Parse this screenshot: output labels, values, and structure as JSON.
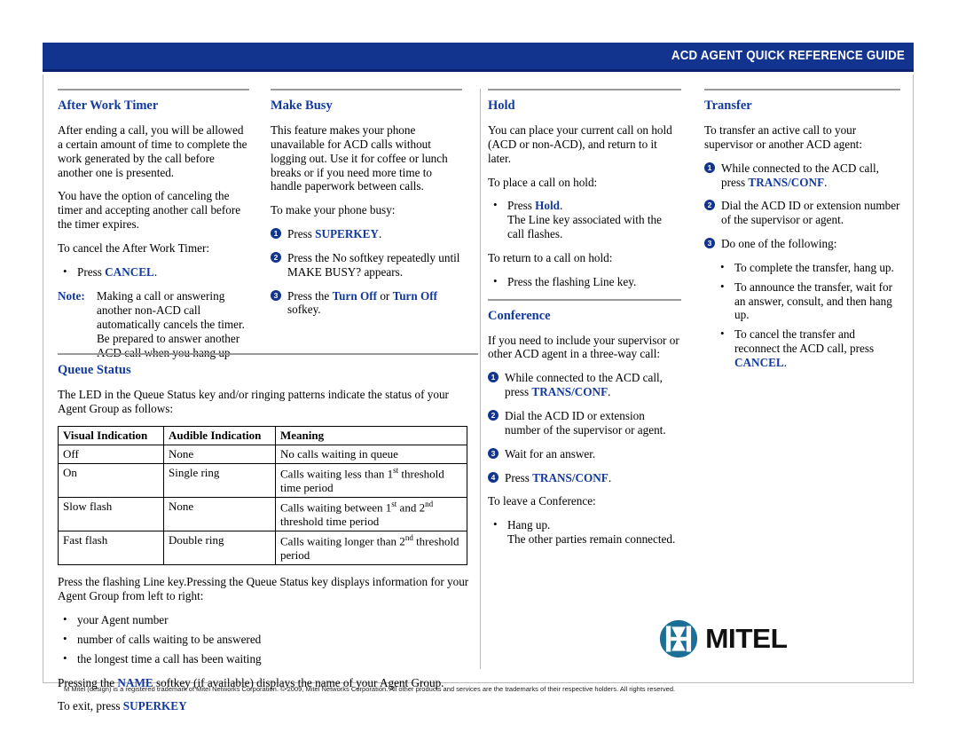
{
  "header": {
    "title": "ACD AGENT QUICK REFERENCE GUIDE"
  },
  "colors": {
    "brand_blue": "#12338e",
    "heading_blue": "#123a9e",
    "logo_teal": "#1b6f96"
  },
  "col1": {
    "heading": "After Work Timer",
    "p1": "After ending a call, you will be allowed a certain amount of time to complete the work generated by the call before another one is presented.",
    "p2": "You have the option of canceling the timer and accepting another call before the timer expires.",
    "p3": "To cancel the After Work Timer:",
    "bullet1_pre": "Press ",
    "bullet1_kw": "CANCEL",
    "bullet1_post": ".",
    "note_label": "Note:",
    "note_text": "Making a call or answering another non-ACD call automatically cancels the timer. Be prepared to answer another ACD call when you hang up"
  },
  "col2": {
    "heading": "Make Busy",
    "p1": "This feature makes your phone unavailable for ACD calls without logging out. Use it for coffee or lunch breaks or if you need more time to handle paperwork between calls.",
    "p2": "To make your phone busy:",
    "step1_num": "1",
    "step1_pre": "Press ",
    "step1_kw": "SUPERKEY",
    "step1_post": ".",
    "step2_num": "2",
    "step2_text": "Press the No softkey repeatedly until MAKE BUSY? appears.",
    "step3_num": "3",
    "step3_pre": "Press the ",
    "step3_kw1": "Turn Off",
    "step3_mid": " or ",
    "step3_kw2": "Turn Off",
    "step3_post": " sofkey."
  },
  "col3": {
    "hold_heading": "Hold",
    "hold_p1": "You can place your current call on hold (ACD or non-ACD), and return to it later.",
    "hold_p2": "To place a call on hold:",
    "hold_b1_pre": "Press ",
    "hold_b1_kw": "Hold",
    "hold_b1_post": ".",
    "hold_b1_line2": "The Line key associated with the call flashes.",
    "hold_p3": "To return to a call on hold:",
    "hold_b2": "Press the flashing Line key.",
    "conf_heading": "Conference",
    "conf_p1": "If you need to include your supervisor or other ACD agent in a three-way call:",
    "conf_step1_num": "1",
    "conf_step1_pre": "While connected to the ACD call, press ",
    "conf_step1_kw": "TRANS/CONF",
    "conf_step1_post": ".",
    "conf_step2_num": "2",
    "conf_step2_text": "Dial the ACD ID or extension number of the supervisor or agent.",
    "conf_step3_num": "3",
    "conf_step3_text": "Wait for an answer.",
    "conf_step4_num": "4",
    "conf_step4_pre": "Press ",
    "conf_step4_kw": "TRANS/CONF",
    "conf_step4_post": ".",
    "conf_p2": "To leave a Conference:",
    "conf_b1": "Hang up.",
    "conf_b1_line2": "The other parties remain connected."
  },
  "col4": {
    "heading": "Transfer",
    "p1": "To transfer an active call to your supervisor or another ACD agent:",
    "step1_num": "1",
    "step1_pre": "While connected to the ACD call, press ",
    "step1_kw": "TRANS/CONF",
    "step1_post": ".",
    "step2_num": "2",
    "step2_text": "Dial the ACD ID or extension number of the supervisor or agent.",
    "step3_num": "3",
    "step3_text": "Do one of the following:",
    "sub1": "To complete the transfer, hang up.",
    "sub2": "To announce the transfer, wait for an answer, consult, and then hang up.",
    "sub3_pre": "To cancel the transfer and reconnect the ACD call, press ",
    "sub3_kw": "CANCEL",
    "sub3_post": "."
  },
  "queue": {
    "heading": "Queue Status",
    "intro": "The LED in the Queue Status key and/or ringing patterns indicate the status of your Agent Group as follows:",
    "table": {
      "headers": [
        "Visual Indication",
        "Audible Indication",
        "Meaning"
      ],
      "rows": [
        {
          "visual": "Off",
          "audible": "None",
          "meaning": "No calls waiting in queue"
        },
        {
          "visual": "On",
          "audible": "Single ring",
          "meaning": "Calls waiting less than 1st threshold time period"
        },
        {
          "visual": "Slow flash",
          "audible": "None",
          "meaning": "Calls waiting between 1st and 2nd threshold time period"
        },
        {
          "visual": "Fast flash",
          "audible": "Double ring",
          "meaning": "Calls waiting longer than 2nd threshold period"
        }
      ]
    },
    "p_after": "Press the flashing Line key.Pressing the Queue Status key displays information for your Agent Group from left to right:",
    "b1": "your Agent number",
    "b2": "number of calls waiting to be answered",
    "b3": "the longest time a call has been waiting",
    "p_name_pre": "Pressing the ",
    "p_name_kw": "NAME",
    "p_name_post": " softkey (if available) displays the name of your Agent Group.",
    "p_exit_pre": "To exit, press ",
    "p_exit_kw": "SUPERKEY"
  },
  "logo": {
    "text": "MITEL"
  },
  "footer": {
    "text": "M Mitel (design) is a registered trademark of Mitel Networks Corporation.  © 2009, Mitel Networks Corporation. All other products and services are the trademarks of their respective holders. All rights reserved."
  }
}
